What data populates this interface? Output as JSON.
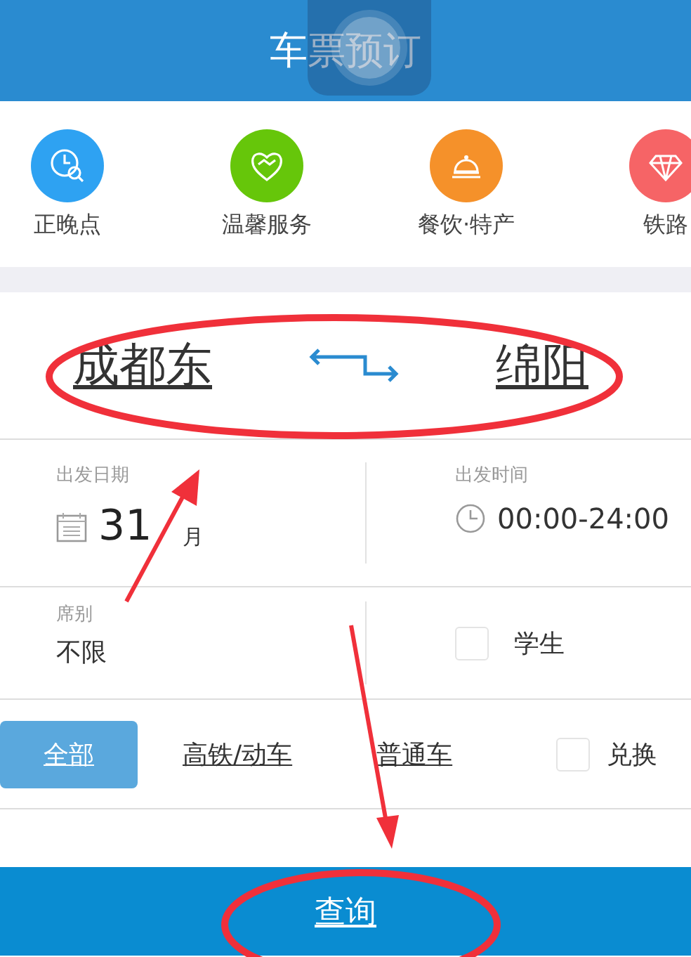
{
  "header": {
    "title": "车票预订"
  },
  "services": [
    {
      "label": "正晚点",
      "color": "#2ea2f2"
    },
    {
      "label": "温馨服务",
      "color": "#66c60a"
    },
    {
      "label": "餐饮·特产",
      "color": "#f5912a"
    },
    {
      "label": "铁路",
      "color": "#f66466"
    }
  ],
  "stations": {
    "from": "成都东",
    "to": "绵阳"
  },
  "date": {
    "label": "出发日期",
    "day": "31",
    "month": "月"
  },
  "time": {
    "label": "出发时间",
    "value": "00:00-24:00"
  },
  "seat": {
    "label": "席别",
    "value": "不限"
  },
  "student": {
    "label": "学生",
    "checked": false
  },
  "train_types": [
    {
      "label": "全部",
      "selected": true
    },
    {
      "label": "高铁/动车",
      "selected": false
    },
    {
      "label": "普通车",
      "selected": false
    }
  ],
  "exchange": {
    "label": "兑换",
    "checked": false
  },
  "query_button": "查询"
}
